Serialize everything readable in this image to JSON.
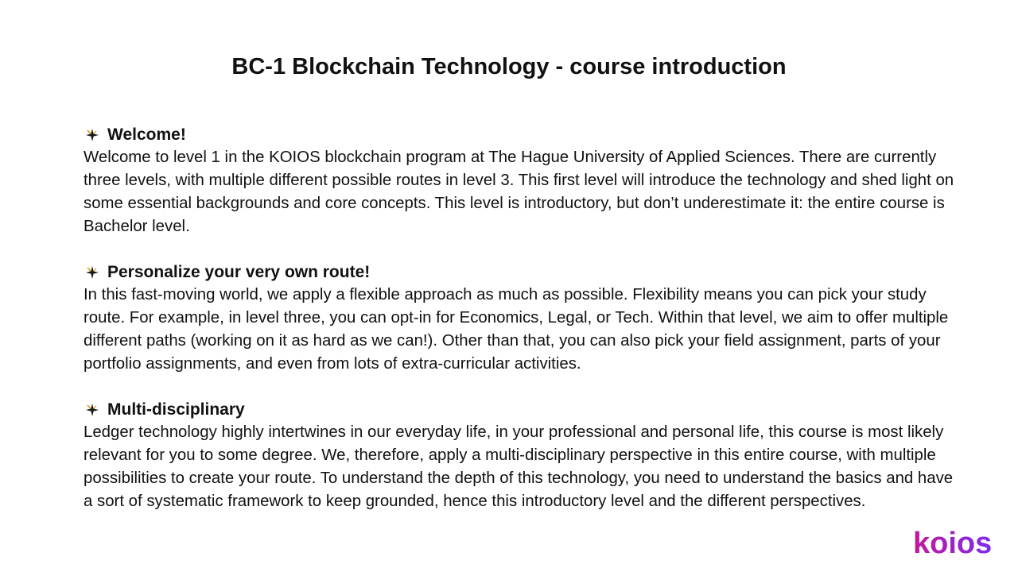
{
  "title": "BC-1 Blockchain Technology - course introduction",
  "sections": [
    {
      "bullet_icon": "star-burst-icon",
      "heading": "Welcome!",
      "body": "Welcome to level 1 in the KOIOS blockchain program at The Hague University of Applied Sciences. There are currently three levels, with multiple different possible routes in level 3. This first level will introduce the technology and shed light on some essential backgrounds and core concepts. This level is introductory, but don’t underestimate it: the entire course is Bachelor level."
    },
    {
      "bullet_icon": "star-burst-icon",
      "heading": "Personalize your very own route!",
      "body": "In this fast-moving world, we apply a flexible approach as much as possible. Flexibility means you can pick your study route. For example, in level three, you can opt-in for Economics, Legal, or Tech. Within that level, we aim to offer multiple different paths (working on it as hard as we can!). Other than that, you can also pick your field assignment, parts of your portfolio assignments, and even from lots of extra-curricular activities."
    },
    {
      "bullet_icon": "star-burst-icon",
      "heading": "Multi-disciplinary",
      "body": "Ledger technology highly intertwines in our everyday life, in your professional and personal life, this course is most likely relevant for you to some degree. We, therefore, apply a multi-disciplinary perspective in this entire course, with multiple possibilities to create your route. To understand the depth of this technology, you need to understand the basics and have a sort of systematic framework to keep grounded, hence this introductory level and the different perspectives."
    }
  ],
  "logo": {
    "text": "koios",
    "gradient_start": "#c2189b",
    "gradient_end": "#7b2cf0"
  }
}
